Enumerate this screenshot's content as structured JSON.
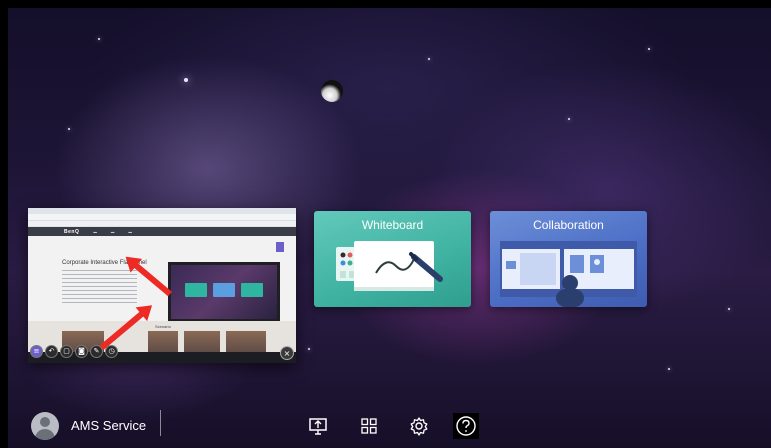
{
  "preview": {
    "brand": "BenQ",
    "page_title": "Corporate Interactive Flat Panel",
    "section_label": "Scenario",
    "close_icon": "close-icon",
    "toolbar_icons": [
      "menu-icon",
      "undo-icon",
      "screenshot-icon",
      "camera-icon",
      "pen-icon",
      "timer-icon"
    ]
  },
  "apps": [
    {
      "title": "Whiteboard",
      "color": "#45b7a7",
      "icon": "whiteboard-icon"
    },
    {
      "title": "Collaboration",
      "color": "#5577cc",
      "icon": "collaboration-icon"
    }
  ],
  "user": {
    "name": "AMS Service",
    "icon": "avatar-icon"
  },
  "dock": [
    {
      "name": "screen-share-icon"
    },
    {
      "name": "apps-grid-icon"
    },
    {
      "name": "settings-icon"
    },
    {
      "name": "help-icon"
    }
  ],
  "colors": {
    "arrow": "#ee2a24",
    "accent": "#6c5fc7"
  }
}
